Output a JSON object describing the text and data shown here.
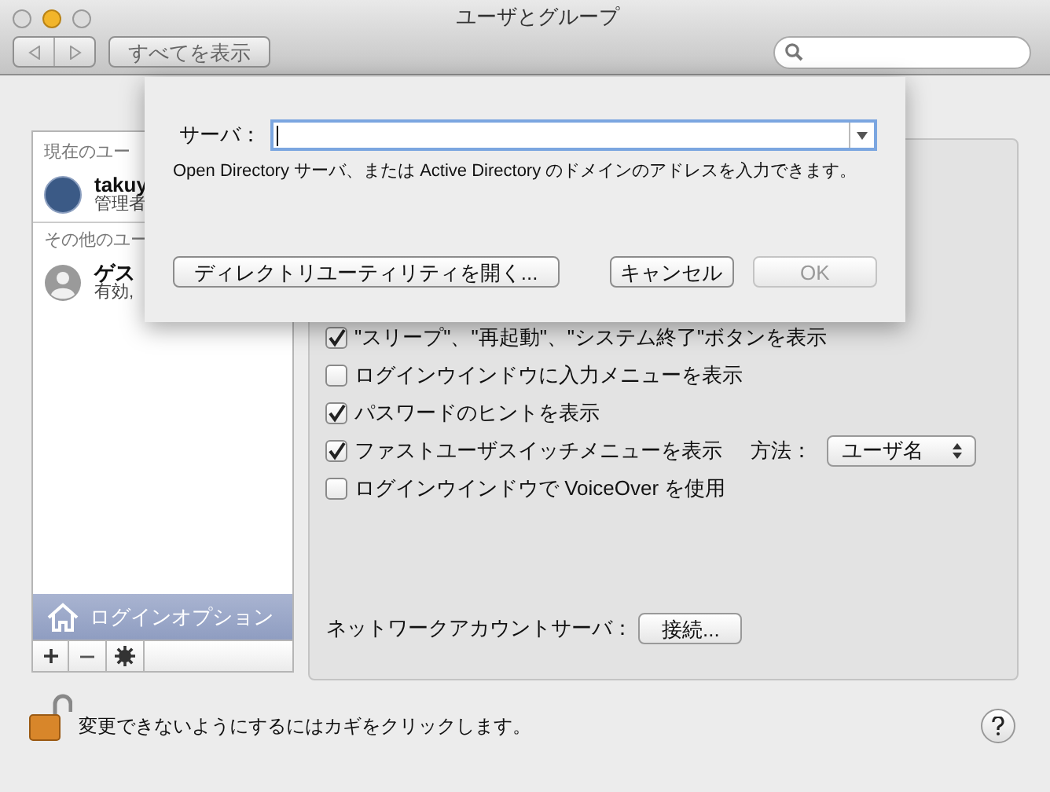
{
  "window": {
    "title": "ユーザとグループ"
  },
  "toolbar": {
    "show_all": "すべてを表示"
  },
  "sidebar": {
    "sections": [
      {
        "header": "現在のユー",
        "users": [
          {
            "name": "takuy",
            "role": "管理者",
            "kind": "photo"
          }
        ]
      },
      {
        "header": "その他のユー",
        "users": [
          {
            "name": "ゲス",
            "role": "有効,",
            "kind": "guest"
          }
        ]
      }
    ],
    "login_options": {
      "label": "ログインオプション",
      "selected": true
    }
  },
  "panel": {
    "options": [
      {
        "label": "\"スリープ\"、\"再起動\"、\"システム終了\"ボタンを表示",
        "checked": true,
        "kind": "checkbox"
      },
      {
        "label": "ログインウインドウに入力メニューを表示",
        "checked": false,
        "kind": "checkbox"
      },
      {
        "label": "パスワードのヒントを表示",
        "checked": true,
        "kind": "checkbox"
      },
      {
        "label": "ファストユーザスイッチメニューを表示",
        "checked": true,
        "kind": "checkbox_with_popup",
        "popup_label": "方法：",
        "popup_value": "ユーザ名"
      },
      {
        "label": "ログインウインドウで VoiceOver を使用",
        "checked": false,
        "kind": "checkbox"
      }
    ],
    "network": {
      "label": "ネットワークアカウントサーバ：",
      "button": "接続..."
    }
  },
  "sheet": {
    "server_label": "サーバ：",
    "hint": "Open Directory サーバ、または Active Directory のドメインのアドレスを入力できます。",
    "buttons": [
      {
        "label": "ディレクトリユーティリティを開く...",
        "disabled": false
      },
      {
        "label": "キャンセル",
        "disabled": false
      },
      {
        "label": "OK",
        "disabled": true
      }
    ]
  },
  "footer": {
    "lock_text": "変更できないようにするにはカギをクリックします。"
  }
}
